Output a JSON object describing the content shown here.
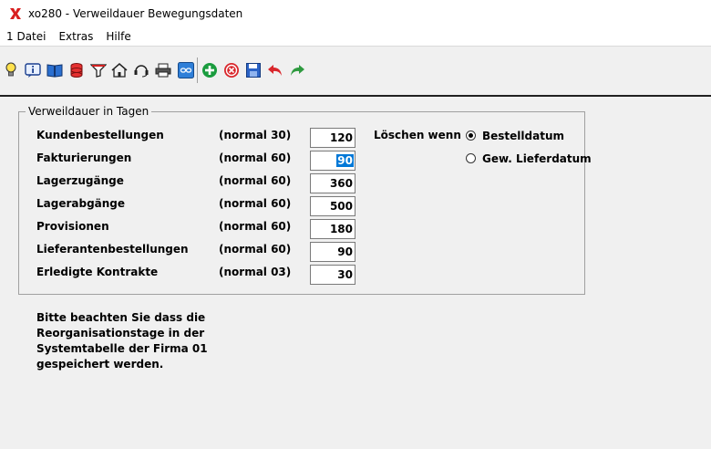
{
  "window": {
    "title": "xo280 - Verweildauer Bewegungsdaten"
  },
  "menu": [
    "1 Datei",
    "Extras",
    "Hilfe"
  ],
  "toolbar": {
    "icons": [
      "lightbulb-icon",
      "info-icon",
      "book-icon",
      "database-icon",
      "filter-icon",
      "home-icon",
      "headset-icon",
      "printer-icon",
      "link-icon",
      "add-icon",
      "delete-icon",
      "save-icon",
      "undo-icon",
      "redo-icon"
    ]
  },
  "group": {
    "title": "Verweildauer in Tagen",
    "rows": [
      {
        "label": "Kundenbestellungen",
        "normal": "(normal 30)",
        "value": "120"
      },
      {
        "label": "Fakturierungen",
        "normal": "(normal 60)",
        "value": "90"
      },
      {
        "label": "Lagerzugänge",
        "normal": "(normal 60)",
        "value": "360"
      },
      {
        "label": "Lagerabgänge",
        "normal": "(normal 60)",
        "value": "500"
      },
      {
        "label": "Provisionen",
        "normal": "(normal 60)",
        "value": "180"
      },
      {
        "label": "Lieferantenbestellungen",
        "normal": "(normal 60)",
        "value": "90"
      },
      {
        "label": "Erledigte Kontrakte",
        "normal": "(normal 03)",
        "value": "30"
      }
    ],
    "delete_when_label": "Löschen wenn",
    "radio_options": [
      {
        "label": "Bestelldatum",
        "checked": true
      },
      {
        "label": "Gew. Lieferdatum",
        "checked": false
      }
    ]
  },
  "note": {
    "lines": [
      "Bitte beachten Sie dass die",
      "Reorganisationstage in der",
      "Systemtabelle der Firma 01",
      "gespeichert werden."
    ]
  },
  "colors": {
    "selection": "#0078d7",
    "add_green": "#1a9c3e",
    "delete_red": "#d9262b",
    "undo_red": "#d9262b",
    "redo_green": "#2e9a3f"
  }
}
